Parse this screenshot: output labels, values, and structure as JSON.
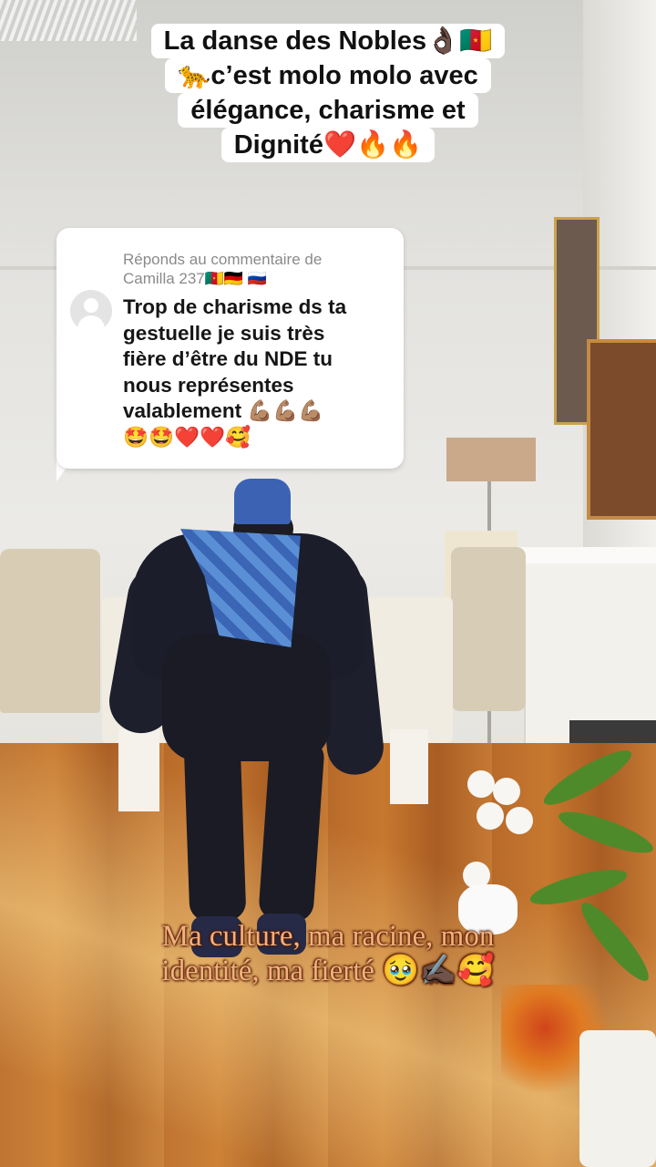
{
  "video_caption": {
    "lines": [
      "La danse des Nobles👌🏿🇨🇲",
      "🐆c’est molo molo avec",
      "élégance, charisme et",
      "Dignité❤️🔥🔥"
    ]
  },
  "reply_card": {
    "label_line1": "Réponds au commentaire de",
    "label_line2": "Camilla 237🇨🇲🇩🇪 🇷🇺",
    "comment_lines": [
      "Trop de charisme ds ta",
      "gestuelle je suis très",
      "fière d’être du NDE tu",
      "nous représentes",
      "valablement 💪🏽💪🏽💪🏽",
      "🤩🤩❤️❤️🥰"
    ],
    "avatar_icon": "default-user-avatar-icon"
  },
  "overlay_text": {
    "line1": "Ma culture, ma racine, mon",
    "line2": "identité, ma fierté 🥹✍🏿🥰"
  }
}
